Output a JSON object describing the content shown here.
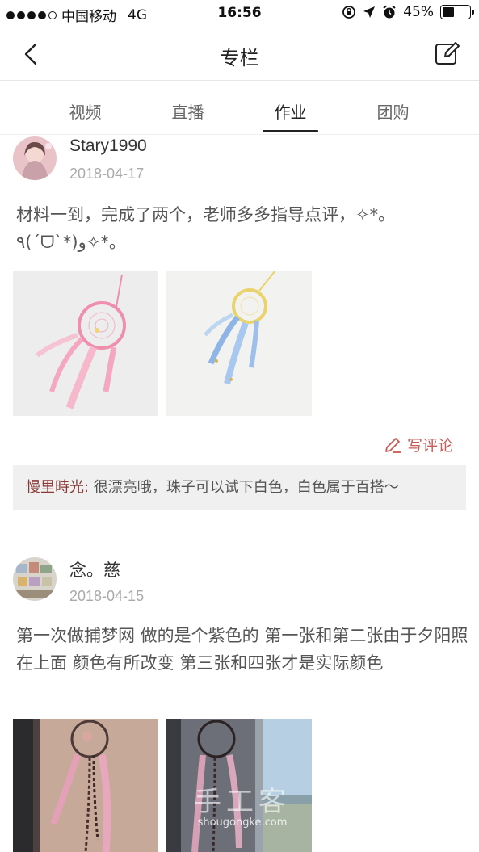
{
  "status_bar": {
    "carrier": "中国移动",
    "network": "4G",
    "time": "16:56",
    "battery": "45%",
    "battery_level": 0.45
  },
  "nav": {
    "title": "专栏",
    "back_icon": "chevron-left-icon",
    "edit_icon": "edit-icon"
  },
  "tabs": [
    {
      "label": "视频",
      "active": false
    },
    {
      "label": "直播",
      "active": false
    },
    {
      "label": "作业",
      "active": true
    },
    {
      "label": "团购",
      "active": false
    }
  ],
  "posts": [
    {
      "author": "Stary1990",
      "date": "2018-04-17",
      "content": "材料一到，完成了两个，老师多多指导点评，✧*。٩(ˊᗜˋ*)و✧*。",
      "comment_action": "写评论",
      "comment": {
        "user": "慢里時光:",
        "text": " 很漂亮哦，珠子可以试下白色，白色属于百搭～"
      }
    },
    {
      "author": "念。慈",
      "date": "2018-04-15",
      "content": "第一次做捕梦网 做的是个紫色的 第一张和第二张由于夕阳照在上面 颜色有所改变 第三张和四张才是实际颜色"
    }
  ],
  "watermark": {
    "logo": "手工客",
    "site": "shougongke.com"
  },
  "colors": {
    "accent": "#c85a55",
    "comment_bg": "#f0f0f0",
    "divider": "#e6e6e6"
  }
}
